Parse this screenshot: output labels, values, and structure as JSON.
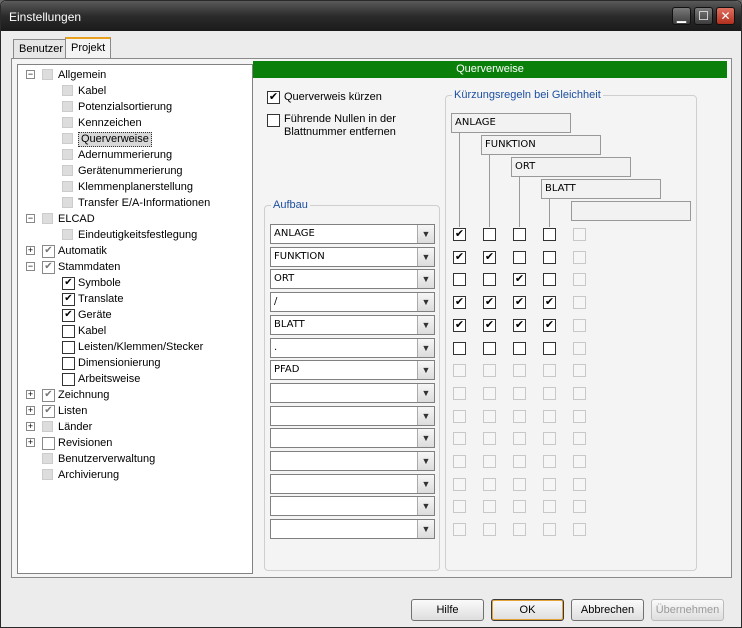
{
  "window": {
    "title": "Einstellungen"
  },
  "tabs": [
    {
      "label": "Benutzer"
    },
    {
      "label": "Projekt"
    }
  ],
  "tree": [
    {
      "label": "Allgemein",
      "level": 0,
      "expander": "−",
      "check": "grey"
    },
    {
      "label": "Kabel",
      "level": 1,
      "check": "grey"
    },
    {
      "label": "Potenzialsortierung",
      "level": 1,
      "check": "grey"
    },
    {
      "label": "Kennzeichen",
      "level": 1,
      "check": "grey"
    },
    {
      "label": "Querverweise",
      "level": 1,
      "check": "grey",
      "selected": true
    },
    {
      "label": "Adernummerierung",
      "level": 1,
      "check": "grey"
    },
    {
      "label": "Gerätenummerierung",
      "level": 1,
      "check": "grey"
    },
    {
      "label": "Klemmenplanerstellung",
      "level": 1,
      "check": "grey"
    },
    {
      "label": "Transfer E/A-Informationen",
      "level": 1,
      "check": "grey"
    },
    {
      "label": "ELCAD",
      "level": 0,
      "expander": "−",
      "check": "grey"
    },
    {
      "label": "Eindeutigkeitsfestlegung",
      "level": 1,
      "check": "grey"
    },
    {
      "label": "Automatik",
      "level": 0,
      "expander": "+",
      "check": "greychecked"
    },
    {
      "label": "Stammdaten",
      "level": 0,
      "expander": "−",
      "check": "greychecked"
    },
    {
      "label": "Symbole",
      "level": 1,
      "check": "checked"
    },
    {
      "label": "Translate",
      "level": 1,
      "check": "checked"
    },
    {
      "label": "Geräte",
      "level": 1,
      "check": "checked"
    },
    {
      "label": "Kabel",
      "level": 1,
      "check": "unchecked"
    },
    {
      "label": "Leisten/Klemmen/Stecker",
      "level": 1,
      "check": "unchecked"
    },
    {
      "label": "Dimensionierung",
      "level": 1,
      "check": "unchecked"
    },
    {
      "label": "Arbeitsweise",
      "level": 1,
      "check": "unchecked"
    },
    {
      "label": "Zeichnung",
      "level": 0,
      "expander": "+",
      "check": "greychecked"
    },
    {
      "label": "Listen",
      "level": 0,
      "expander": "+",
      "check": "greychecked"
    },
    {
      "label": "Länder",
      "level": 0,
      "expander": "+",
      "check": "grey"
    },
    {
      "label": "Revisionen",
      "level": 0,
      "expander": "+",
      "check": "greyempty"
    },
    {
      "label": "Benutzerverwaltung",
      "level": 0,
      "check": "grey"
    },
    {
      "label": "Archivierung",
      "level": 0,
      "check": "grey"
    }
  ],
  "panel": {
    "title": "Querverweise",
    "option_shorten": {
      "label": "Querverweis kürzen",
      "checked": true
    },
    "option_zeros": {
      "label": "Führende Nullen in der Blattnummer entfernen",
      "checked": false
    },
    "aufbau_label": "Aufbau",
    "rules_label": "Kürzungsregeln bei Gleichheit",
    "rule_headers": [
      "ANLAGE",
      "FUNKTION",
      "ORT",
      "BLATT",
      ""
    ],
    "rows": [
      {
        "value": "ANLAGE",
        "checks": [
          true,
          false,
          false,
          false,
          false
        ],
        "enabled": true
      },
      {
        "value": "FUNKTION",
        "checks": [
          true,
          true,
          false,
          false,
          false
        ],
        "enabled": true
      },
      {
        "value": "ORT",
        "checks": [
          false,
          false,
          true,
          false,
          false
        ],
        "enabled": true
      },
      {
        "value": "/",
        "checks": [
          true,
          true,
          true,
          true,
          false
        ],
        "enabled": true
      },
      {
        "value": "BLATT",
        "checks": [
          true,
          true,
          true,
          true,
          false
        ],
        "enabled": true
      },
      {
        "value": ".",
        "checks": [
          false,
          false,
          false,
          false,
          false
        ],
        "enabled": true
      },
      {
        "value": "PFAD",
        "checks": [
          false,
          false,
          false,
          false,
          false
        ],
        "enabled": false
      },
      {
        "value": "",
        "checks": [
          false,
          false,
          false,
          false,
          false
        ],
        "enabled": false
      },
      {
        "value": "",
        "checks": [
          false,
          false,
          false,
          false,
          false
        ],
        "enabled": false
      },
      {
        "value": "",
        "checks": [
          false,
          false,
          false,
          false,
          false
        ],
        "enabled": false
      },
      {
        "value": "",
        "checks": [
          false,
          false,
          false,
          false,
          false
        ],
        "enabled": false
      },
      {
        "value": "",
        "checks": [
          false,
          false,
          false,
          false,
          false
        ],
        "enabled": false
      },
      {
        "value": "",
        "checks": [
          false,
          false,
          false,
          false,
          false
        ],
        "enabled": false
      },
      {
        "value": "",
        "checks": [
          false,
          false,
          false,
          false,
          false
        ],
        "enabled": false
      }
    ]
  },
  "buttons": {
    "help": "Hilfe",
    "ok": "OK",
    "cancel": "Abbrechen",
    "apply": "Übernehmen"
  }
}
